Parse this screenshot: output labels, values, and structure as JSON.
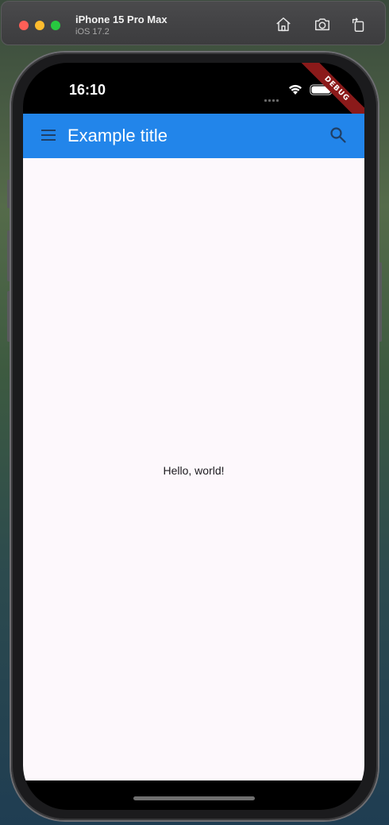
{
  "simulator": {
    "device_name": "iPhone 15 Pro Max",
    "os_version": "iOS 17.2",
    "buttons": [
      {
        "name": "home",
        "icon": "home-icon"
      },
      {
        "name": "screenshot",
        "icon": "camera-icon"
      },
      {
        "name": "rotate",
        "icon": "rotate-icon"
      }
    ]
  },
  "status_bar": {
    "time": "16:10"
  },
  "debug_banner": "DEBUG",
  "app_bar": {
    "title": "Example title",
    "leading_icon": "menu-icon",
    "trailing_icon": "search-icon",
    "color": "#2285ea"
  },
  "body": {
    "text": "Hello, world!",
    "background": "#fdf8fc"
  }
}
